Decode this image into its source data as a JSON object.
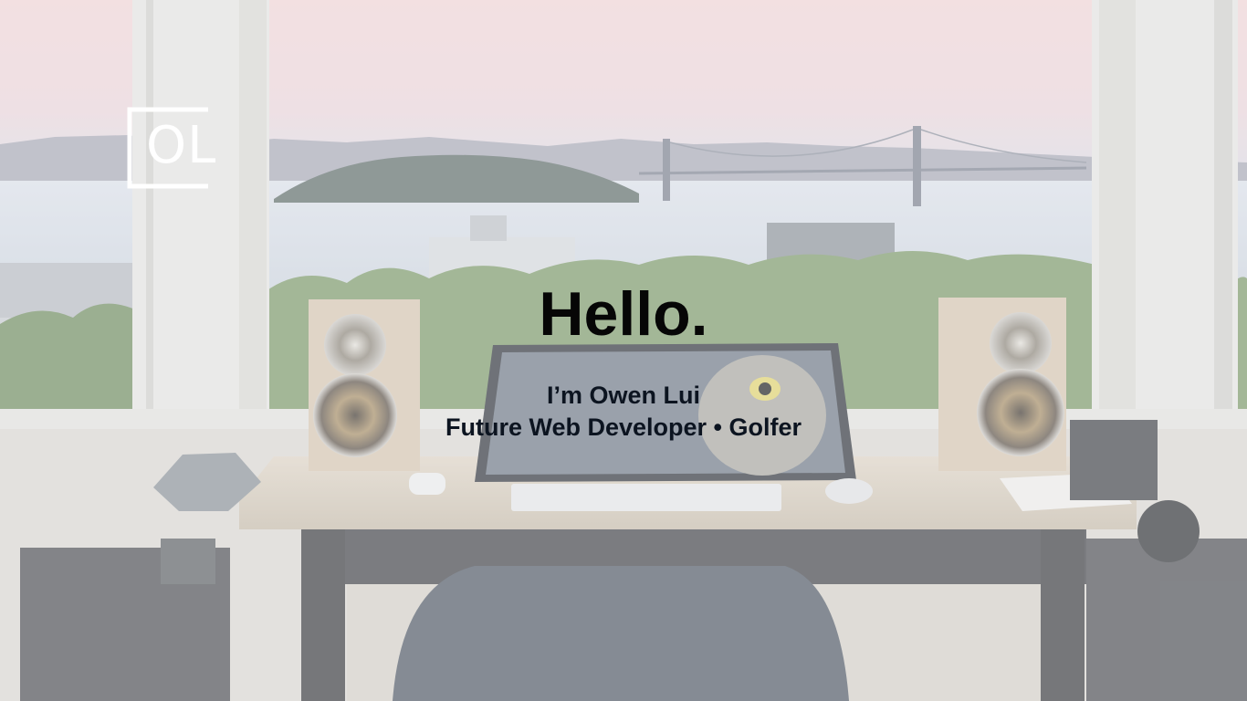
{
  "logo": {
    "text": "OL"
  },
  "hero": {
    "headline": "Hello.",
    "intro_line": "I’m Owen Lui",
    "tagline": "Future Web Developer • Golfer"
  },
  "colors": {
    "headline": "#060606",
    "subtext": "#0c1420",
    "logo": "#ffffff",
    "overlay": "#eef1f4"
  }
}
